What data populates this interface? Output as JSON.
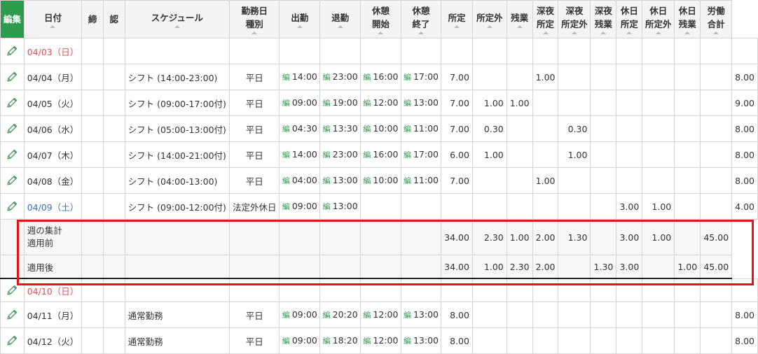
{
  "header": {
    "edit": "編集",
    "date": "日付",
    "close": "締",
    "approve": "認",
    "schedule": "スケジュール",
    "workday_type_1": "勤務日",
    "workday_type_2": "種別",
    "clock_in": "出勤",
    "clock_out": "退勤",
    "break_start_1": "休憩",
    "break_start_2": "開始",
    "break_end_1": "休憩",
    "break_end_2": "終了",
    "scheduled": "所定",
    "overtime_scheduled": "所定外",
    "overtime": "残業",
    "night_1": "深夜",
    "night_2": "所定",
    "night_ot_1": "深夜",
    "night_ot_2": "所定外",
    "night_extra_1": "深夜",
    "night_extra_2": "残業",
    "holiday_1": "休日",
    "holiday_2": "所定",
    "holiday_ot_1": "休日",
    "holiday_ot_2": "所定外",
    "holiday_extra_1": "休日",
    "holiday_extra_2": "残業",
    "labor_total_1": "労働",
    "labor_total_2": "合計"
  },
  "edit_marker": "編",
  "rows": [
    {
      "date": "04/03（日）",
      "kind": "sun",
      "schedule": "",
      "type": "",
      "in": "",
      "out": "",
      "bs": "",
      "be": "",
      "c": [
        "",
        "",
        "",
        "",
        "",
        "",
        "",
        "",
        "",
        ""
      ],
      "total": ""
    },
    {
      "date": "04/04（月）",
      "kind": "",
      "schedule": "シフト (14:00-23:00)",
      "type": "平日",
      "in": "14:00",
      "out": "23:00",
      "bs": "16:00",
      "be": "17:00",
      "c": [
        "7.00",
        "",
        "",
        "1.00",
        "",
        "",
        "",
        "",
        "",
        ""
      ],
      "total": "8.00"
    },
    {
      "date": "04/05（火）",
      "kind": "",
      "schedule": "シフト (09:00-17:00付)",
      "type": "平日",
      "in": "09:00",
      "out": "19:00",
      "bs": "12:00",
      "be": "13:00",
      "c": [
        "7.00",
        "1.00",
        "1.00",
        "",
        "",
        "",
        "",
        "",
        "",
        ""
      ],
      "total": "9.00"
    },
    {
      "date": "04/06（水）",
      "kind": "",
      "schedule": "シフト (05:00-13:00付)",
      "type": "平日",
      "in": "04:30",
      "out": "13:30",
      "bs": "10:00",
      "be": "11:00",
      "c": [
        "7.00",
        "0.30",
        "",
        "",
        "0.30",
        "",
        "",
        "",
        "",
        ""
      ],
      "total": "8.00"
    },
    {
      "date": "04/07（木）",
      "kind": "",
      "schedule": "シフト (14:00-21:00付)",
      "type": "平日",
      "in": "14:00",
      "out": "23:00",
      "bs": "16:00",
      "be": "17:00",
      "c": [
        "6.00",
        "1.00",
        "",
        "",
        "1.00",
        "",
        "",
        "",
        "",
        ""
      ],
      "total": "8.00"
    },
    {
      "date": "04/08（金）",
      "kind": "",
      "schedule": "シフト (04:00-13:00)",
      "type": "平日",
      "in": "04:00",
      "out": "13:00",
      "bs": "10:00",
      "be": "11:00",
      "c": [
        "7.00",
        "",
        "",
        "1.00",
        "",
        "",
        "",
        "",
        "",
        ""
      ],
      "total": "8.00"
    },
    {
      "date": "04/09（土）",
      "kind": "sat",
      "schedule": "シフト (09:00-12:00付)",
      "type": "法定外休日",
      "in": "09:00",
      "out": "13:00",
      "bs": "",
      "be": "",
      "c": [
        "",
        "",
        "",
        "",
        "",
        "",
        "3.00",
        "1.00",
        "",
        ""
      ],
      "total": "4.00"
    }
  ],
  "summary": {
    "label_1": "週の集計",
    "label_2": "適用前",
    "before": [
      "34.00",
      "2.30",
      "1.00",
      "2.00",
      "1.30",
      "",
      "3.00",
      "1.00",
      "",
      "45.00"
    ],
    "after_label": "適用後",
    "after": [
      "34.00",
      "1.00",
      "2.30",
      "2.00",
      "",
      "1.30",
      "3.00",
      "",
      "1.00",
      "45.00"
    ]
  },
  "rows2": [
    {
      "date": "04/10（日）",
      "kind": "sun",
      "schedule": "",
      "type": "",
      "in": "",
      "out": "",
      "bs": "",
      "be": "",
      "c": [
        "",
        "",
        "",
        "",
        "",
        "",
        "",
        "",
        "",
        ""
      ],
      "total": ""
    },
    {
      "date": "04/11（月）",
      "kind": "",
      "schedule": "通常勤務",
      "type": "平日",
      "in": "09:00",
      "out": "20:20",
      "bs": "12:00",
      "be": "13:00",
      "c": [
        "8.00",
        "",
        "",
        "",
        "",
        "",
        "",
        "",
        "",
        ""
      ],
      "total": "8.00"
    },
    {
      "date": "04/12（火）",
      "kind": "",
      "schedule": "通常勤務",
      "type": "平日",
      "in": "09:00",
      "out": "18:20",
      "bs": "12:00",
      "be": "13:00",
      "c": [
        "8.00",
        "",
        "",
        "",
        "",
        "",
        "",
        "",
        "",
        ""
      ],
      "total": "8.00"
    }
  ]
}
